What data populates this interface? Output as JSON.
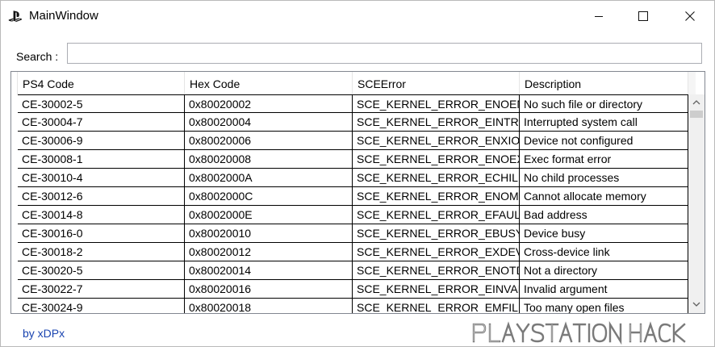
{
  "window": {
    "title": "MainWindow",
    "icon": "playstation-logo-icon",
    "controls": [
      "minimize-icon",
      "maximize-icon",
      "close-icon"
    ]
  },
  "search": {
    "label": "Search :",
    "value": "",
    "placeholder": ""
  },
  "table": {
    "columns": [
      "PS4 Code",
      "Hex Code",
      "SCEError",
      "Description"
    ],
    "rows": [
      [
        "CE-30002-5",
        "0x80020002",
        "SCE_KERNEL_ERROR_ENOENT",
        "No such file or directory"
      ],
      [
        "CE-30004-7",
        "0x80020004",
        "SCE_KERNEL_ERROR_EINTR",
        "Interrupted system call"
      ],
      [
        "CE-30006-9",
        "0x80020006",
        "SCE_KERNEL_ERROR_ENXIO",
        "Device not configured"
      ],
      [
        "CE-30008-1",
        "0x80020008",
        "SCE_KERNEL_ERROR_ENOEXEC",
        "Exec format error"
      ],
      [
        "CE-30010-4",
        "0x8002000A",
        "SCE_KERNEL_ERROR_ECHILD",
        "No child processes"
      ],
      [
        "CE-30012-6",
        "0x8002000C",
        "SCE_KERNEL_ERROR_ENOMEM",
        "Cannot allocate memory"
      ],
      [
        "CE-30014-8",
        "0x8002000E",
        "SCE_KERNEL_ERROR_EFAULT",
        "Bad address"
      ],
      [
        "CE-30016-0",
        "0x80020010",
        "SCE_KERNEL_ERROR_EBUSY",
        "Device busy"
      ],
      [
        "CE-30018-2",
        "0x80020012",
        "SCE_KERNEL_ERROR_EXDEV",
        "Cross-device link"
      ],
      [
        "CE-30020-5",
        "0x80020014",
        "SCE_KERNEL_ERROR_ENOTDIR",
        "Not a directory"
      ],
      [
        "CE-30022-7",
        "0x80020016",
        "SCE_KERNEL_ERROR_EINVAL",
        "Invalid argument"
      ],
      [
        "CE-30024-9",
        "0x80020018",
        "SCE_KERNEL_ERROR_EMFILE",
        "Too many open files"
      ]
    ]
  },
  "footer": {
    "link": "by xDPx"
  },
  "watermark": {
    "text": "PLAYSTATIONHACK"
  },
  "colors": {
    "link": "#1a44b0",
    "grid_line": "#000000",
    "border": "#828790"
  }
}
